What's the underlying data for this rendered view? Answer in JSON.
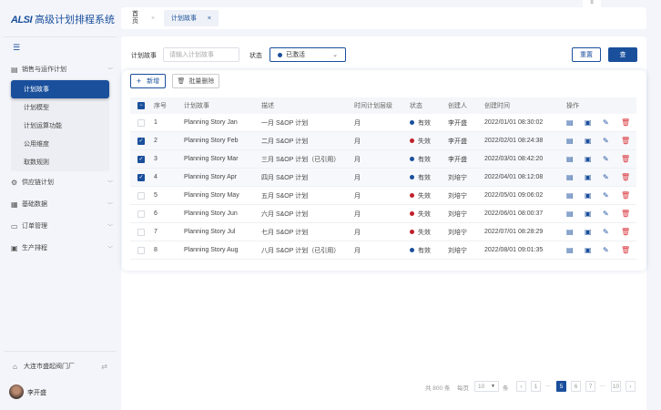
{
  "app": {
    "logo_mark": "ALSI",
    "title": "高级计划排程系统"
  },
  "sidebar": {
    "groups": [
      {
        "label": "销售与运作计划",
        "icon": "document-icon",
        "expanded": true,
        "items": [
          {
            "label": "计划故事",
            "active": true
          },
          {
            "label": "计划模型"
          },
          {
            "label": "计划运算功能"
          },
          {
            "label": "公用维度"
          },
          {
            "label": "取数规则"
          }
        ]
      },
      {
        "label": "供应链计划",
        "icon": "gear-icon"
      },
      {
        "label": "基础数据",
        "icon": "database-icon"
      },
      {
        "label": "订单管理",
        "icon": "order-icon"
      },
      {
        "label": "生产排程",
        "icon": "calendar-icon"
      }
    ],
    "company": "大连市盛起阀门厂",
    "user": "李开盛"
  },
  "tabs": [
    {
      "label": "首页"
    },
    {
      "label": "计划故事",
      "active": true
    }
  ],
  "filter": {
    "story_label": "计划故事",
    "story_placeholder": "请输入计划故事",
    "status_label": "状态",
    "status_value": "已激活",
    "reset": "重置",
    "query": "查"
  },
  "toolbar": {
    "add": "新增",
    "batch_delete": "批量删除"
  },
  "table": {
    "headers": [
      "序号",
      "计划故事",
      "描述",
      "时间计划层级",
      "状态",
      "创建人",
      "创建时间",
      "操作"
    ],
    "rows": [
      {
        "no": "1",
        "story": "Planning Story Jan",
        "desc": "一月 S&OP 计划",
        "level": "月",
        "status": "有效",
        "creator": "李开盛",
        "time": "2022/01/01  08:30:02",
        "checked": false
      },
      {
        "no": "2",
        "story": "Planning Story Feb",
        "desc": "二月 S&OP 计划",
        "level": "月",
        "status": "失效",
        "creator": "李开盛",
        "time": "2022/02/01  08:24:38",
        "checked": true
      },
      {
        "no": "3",
        "story": "Planning Story Mar",
        "desc": "三月 S&OP 计划（已引用）",
        "level": "月",
        "status": "有效",
        "creator": "李开盛",
        "time": "2022/03/01  08:42:20",
        "checked": true
      },
      {
        "no": "4",
        "story": "Planning Story Apr",
        "desc": "四月 S&OP 计划",
        "level": "月",
        "status": "有效",
        "creator": "刘培宁",
        "time": "2022/04/01  08:12:08",
        "checked": true
      },
      {
        "no": "5",
        "story": "Planning Story May",
        "desc": "五月 S&OP 计划",
        "level": "月",
        "status": "失效",
        "creator": "刘培宁",
        "time": "2022/05/01  09:06:02",
        "checked": false
      },
      {
        "no": "6",
        "story": "Planning Story Jun",
        "desc": "六月 S&OP 计划",
        "level": "月",
        "status": "失效",
        "creator": "刘培宁",
        "time": "2022/06/01  08:00:37",
        "checked": false
      },
      {
        "no": "7",
        "story": "Planning Story Jul",
        "desc": "七月 S&OP 计划",
        "level": "月",
        "status": "失效",
        "creator": "刘培宁",
        "time": "2022/07/01  08:28:29",
        "checked": false
      },
      {
        "no": "8",
        "story": "Planning Story Aug",
        "desc": "八月 S&OP 计划（已引用）",
        "level": "月",
        "status": "有效",
        "creator": "刘培宁",
        "time": "2022/08/01  09:01:35",
        "checked": false
      }
    ]
  },
  "pagination": {
    "total": "共 800 条",
    "per_page_label": "每页",
    "per_page": "10",
    "unit": "条",
    "pages": [
      "1",
      "…",
      "5",
      "6",
      "7",
      "…",
      "10"
    ],
    "current": "5"
  },
  "colors": {
    "primary": "#1a4f9c",
    "valid": "#1a4f9c",
    "invalid": "#c0202a",
    "delete": "#d9363e"
  }
}
